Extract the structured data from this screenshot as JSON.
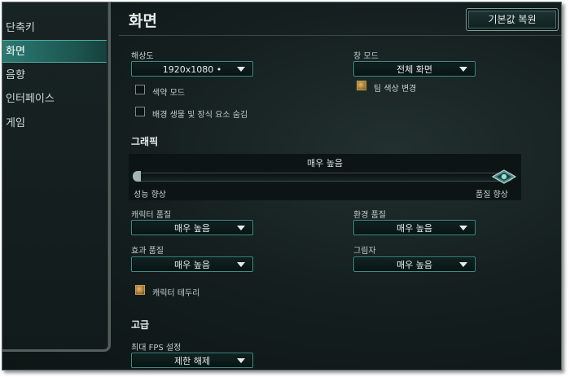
{
  "sidebar": {
    "items": [
      {
        "label": "단축키",
        "active": false
      },
      {
        "label": "화면",
        "active": true
      },
      {
        "label": "음향",
        "active": false
      },
      {
        "label": "인터페이스",
        "active": false
      },
      {
        "label": "게임",
        "active": false
      }
    ]
  },
  "header": {
    "title": "화면",
    "reset_label": "기본값 복원"
  },
  "resolution": {
    "label": "해상도",
    "value": "1920x1080 •"
  },
  "window_mode": {
    "label": "창 모드",
    "value": "전체 화면"
  },
  "options": {
    "colorblind": {
      "label": "색약 모드",
      "checked": false
    },
    "hide_eyecandy": {
      "label": "배경 생물 및 장식 요소 숨김",
      "checked": false
    },
    "team_color": {
      "label": "팀 색상 변경",
      "checked": true
    }
  },
  "graphics": {
    "title": "그래픽",
    "slider_value": "매우 높음",
    "slider_level": 1.0,
    "left_label": "성능 향상",
    "right_label": "품질 향상",
    "character_quality": {
      "label": "캐릭터 품질",
      "value": "매우 높음"
    },
    "environment_quality": {
      "label": "환경 품질",
      "value": "매우 높음"
    },
    "effects_quality": {
      "label": "효과 품질",
      "value": "매우 높음"
    },
    "shadows": {
      "label": "그림자",
      "value": "매우 높음"
    },
    "character_outline": {
      "label": "캐릭터 테두리",
      "checked": true
    }
  },
  "advanced": {
    "title": "고급",
    "fps_cap": {
      "label": "최대 FPS 설정",
      "value": "제한 해제"
    }
  },
  "colors": {
    "accent": "#2c7a73",
    "checkbox_gold": "#c7a058",
    "background": "#10191a"
  }
}
